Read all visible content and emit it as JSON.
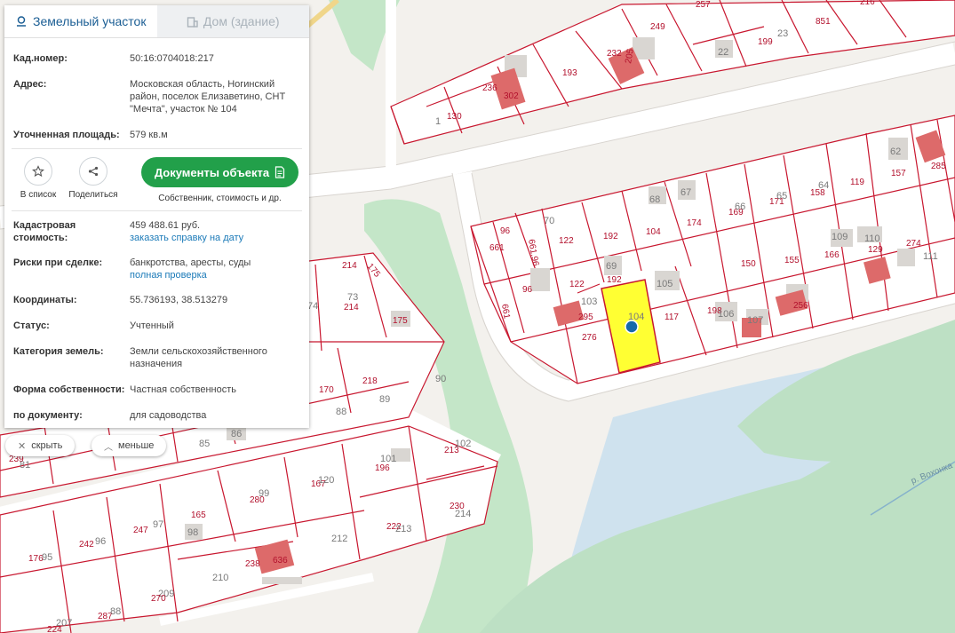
{
  "panel": {
    "tabs": [
      {
        "label": "Земельный участок"
      },
      {
        "label": "Дом (здание)"
      }
    ],
    "cad_number": {
      "label": "Кад.номер:",
      "value": "50:16:0704018:217"
    },
    "address": {
      "label": "Адрес:",
      "value": "Московская область, Ногинский район, поселок Елизаветино, СНТ \"Мечта\", участок № 104"
    },
    "area": {
      "label": "Уточненная площадь:",
      "value": "579 кв.м"
    },
    "actions": {
      "add_to_list": "В список",
      "share": "Поделиться",
      "documents_button": "Документы объекта",
      "documents_sub": "Собственник, стоимость и др."
    },
    "cad_cost": {
      "label": "Кадастровая стоимость:",
      "value": "459 488.61 руб.",
      "link": "заказать справку на дату"
    },
    "risks": {
      "label": "Риски при сделке:",
      "value": "банкротства, аресты, суды",
      "link": "полная проверка"
    },
    "coords": {
      "label": "Координаты:",
      "value": "55.736193, 38.513279"
    },
    "status": {
      "label": "Статус:",
      "value": "Учтенный"
    },
    "land_category": {
      "label": "Категория земель:",
      "value": "Земли сельскохозяйственного назначения"
    },
    "ownership": {
      "label": "Форма собственности:",
      "value": "Частная собственность"
    },
    "by_document": {
      "label": "по документу:",
      "value": "для садоводства"
    }
  },
  "controls": {
    "hide": "скрыть",
    "less": "меньше"
  },
  "map": {
    "colors": {
      "border": "#c8172f",
      "selected": "#ffff33",
      "building": "#d9d6d2",
      "red_building": "#dd6a6a",
      "water": "#cfe2ee",
      "green": "#bfe2c6",
      "marker": "#1769aa"
    },
    "river_label": "р. Вохонка",
    "parcel_labels": [
      "851",
      "216",
      "257",
      "249",
      "199",
      "23",
      "232",
      "205",
      "236",
      "302",
      "193",
      "22",
      "130",
      "1",
      "62",
      "157",
      "285",
      "68",
      "67",
      "158",
      "64",
      "119",
      "171",
      "65",
      "169",
      "66",
      "174",
      "104",
      "192",
      "122",
      "70",
      "661",
      "96",
      "661,96",
      "109",
      "110",
      "129",
      "274",
      "111",
      "69",
      "166",
      "155",
      "150",
      "122",
      "192",
      "96",
      "661",
      "105",
      "103",
      "295",
      "276",
      "117",
      "198",
      "106",
      "107",
      "256",
      "214",
      "175",
      "73",
      "214",
      "74",
      "175",
      "218",
      "170",
      "89",
      "88",
      "90",
      "85",
      "86",
      "239",
      "81",
      "102",
      "213",
      "101",
      "196",
      "167",
      "120",
      "280",
      "99",
      "230",
      "214",
      "165",
      "247",
      "97",
      "242",
      "96",
      "176",
      "95",
      "98",
      "238",
      "636",
      "212",
      "222",
      "213",
      "210",
      "209",
      "270",
      "287",
      "88",
      "207",
      "224",
      "104"
    ]
  }
}
